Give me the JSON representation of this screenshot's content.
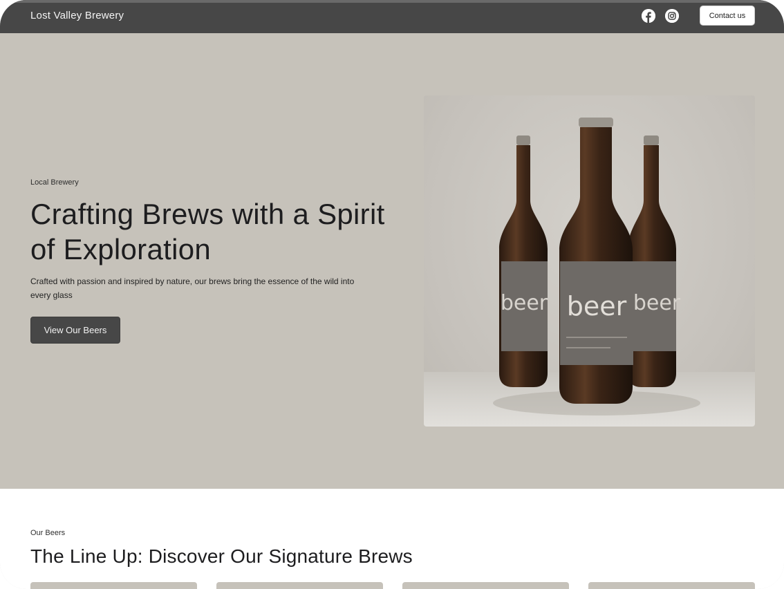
{
  "header": {
    "brand": "Lost Valley Brewery",
    "contact_label": "Contact us",
    "social": [
      {
        "icon": "facebook-icon"
      },
      {
        "icon": "instagram-icon"
      }
    ]
  },
  "hero": {
    "eyebrow": "Local Brewery",
    "title": "Crafting Brews with a Spirit of Exploration",
    "text": "Crafted with passion and inspired by nature, our brews bring the essence of the wild into every glass",
    "cta_label": "View Our Beers",
    "image_label": "beer"
  },
  "beers": {
    "eyebrow": "Our Beers",
    "title": "The Line Up: Discover Our Signature Brews",
    "card_count": 4
  },
  "colors": {
    "header_bg": "#474747",
    "hero_bg": "#c6c2ba",
    "button_dark": "#474747",
    "text_dark": "#1d1d1f"
  }
}
